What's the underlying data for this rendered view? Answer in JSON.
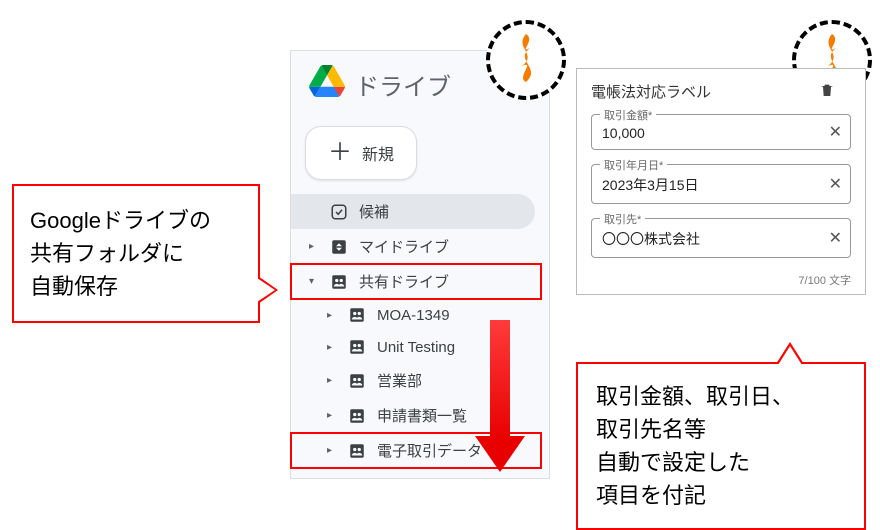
{
  "callout_left": "Googleドライブの\n共有フォルダに\n自動保存",
  "callout_right": "取引金額、取引日、\n取引先名等\n自動で設定した\n項目を付記",
  "drive": {
    "title": "ドライブ",
    "new_button": "新規",
    "items": [
      {
        "label": "候補"
      },
      {
        "label": "マイドライブ"
      },
      {
        "label": "共有ドライブ"
      }
    ],
    "shared_children": [
      {
        "label": "MOA-1349"
      },
      {
        "label": "Unit Testing"
      },
      {
        "label": "営業部"
      },
      {
        "label": "申請書類一覧"
      },
      {
        "label": "電子取引データ"
      }
    ]
  },
  "label_panel": {
    "title": "電帳法対応ラベル",
    "fields": [
      {
        "label": "取引金額*",
        "value": "10,000"
      },
      {
        "label": "取引年月日*",
        "value": "2023年3月15日"
      },
      {
        "label": "取引先*",
        "value": "〇〇〇株式会社"
      }
    ],
    "char_count": "7/100 文字"
  }
}
